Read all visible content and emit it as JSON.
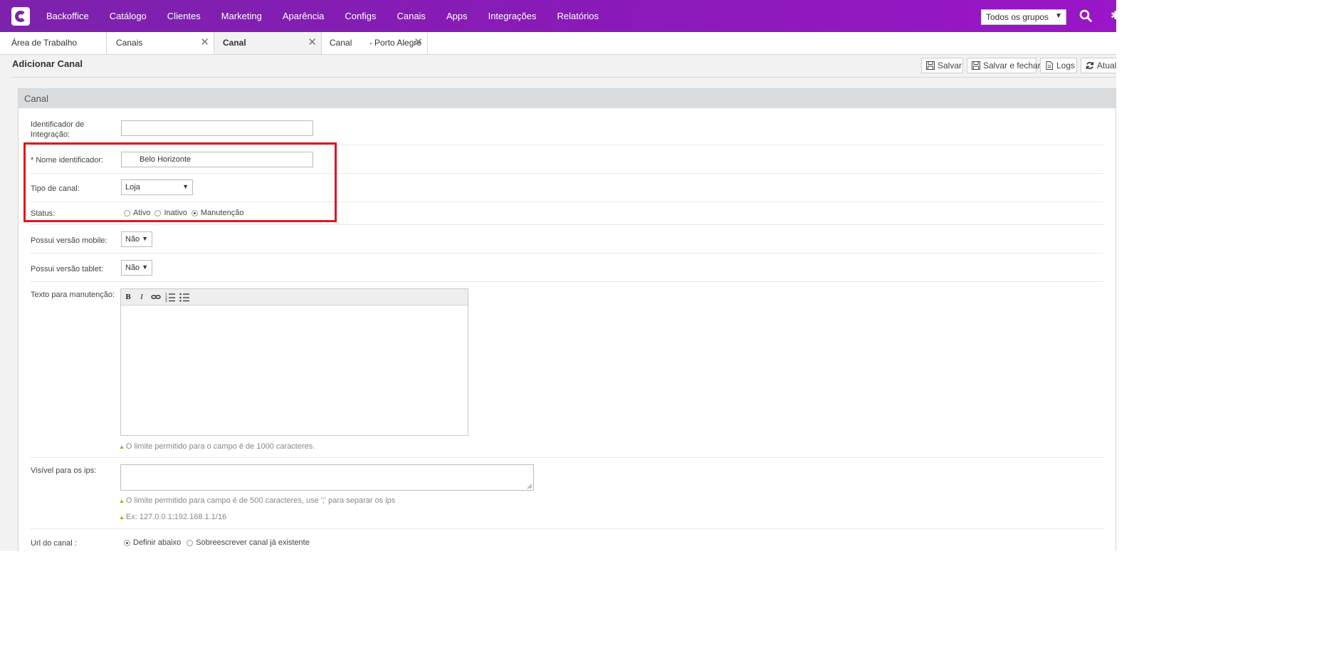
{
  "nav": {
    "items": [
      "Backoffice",
      "Catálogo",
      "Clientes",
      "Marketing",
      "Aparência",
      "Configs",
      "Canais",
      "Apps",
      "Integrações",
      "Relatórios"
    ],
    "group_select": "Todos os grupos"
  },
  "tabs": [
    {
      "label": "Área de Trabalho"
    },
    {
      "label": "Canais"
    },
    {
      "label": "Canal"
    },
    {
      "label": "Canal",
      "suffix": "- Porto Alegre"
    }
  ],
  "page": {
    "title": "Adicionar Canal",
    "buttons": {
      "save": "Salvar",
      "save_close": "Salvar e fechar",
      "logs": "Logs",
      "refresh": "Atuali"
    }
  },
  "panel": {
    "title": "Canal",
    "fields": {
      "integration_id": {
        "label": "Identificador de Integração:",
        "value": ""
      },
      "name": {
        "label": "* Nome identificador:",
        "value": "Belo Horizonte"
      },
      "channel_type": {
        "label": "Tipo de canal:",
        "value": "Loja"
      },
      "status": {
        "label": "Status:",
        "options": [
          "Ativo",
          "Inativo",
          "Manutenção"
        ],
        "selected": "Manutenção"
      },
      "mobile": {
        "label": "Possui versão mobile:",
        "value": "Não"
      },
      "tablet": {
        "label": "Possui versão tablet:",
        "value": "Não"
      },
      "maintenance_text": {
        "label": "Texto para manutenção:",
        "hint": "O limite permitido para o campo é de 1000 caracteres."
      },
      "visible_ips": {
        "label": "Visível para os ips:",
        "hint": "O limite permitido para campo é de 500 caracteres, use ';' para separar os ips",
        "example": "Ex: 127.0.0.1;192.168.1.1/16"
      },
      "url": {
        "label": "Url do canal :",
        "options": [
          "Definir abaixo",
          "Sobreescrever canal já existente"
        ],
        "selected": "Definir abaixo"
      }
    }
  },
  "colors": {
    "topbar": "#8a1ab8",
    "highlight": "#e2151f",
    "accent_hint": "#7ab800"
  }
}
